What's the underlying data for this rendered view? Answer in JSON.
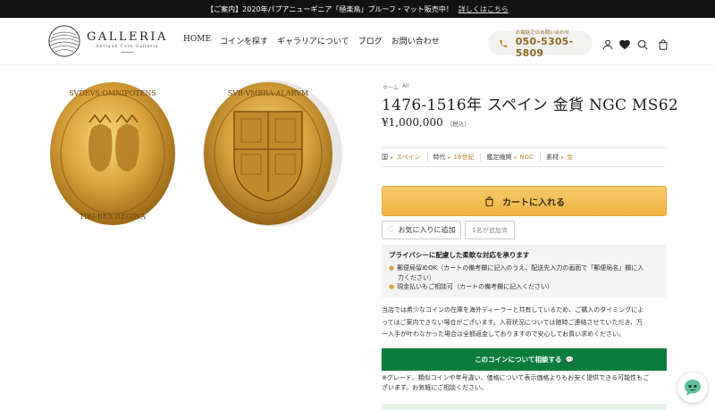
{
  "announcement": {
    "text": "【ご案内】2020年パプアニューギニア「極楽鳥」プルーフ・マット販売中！",
    "link": "詳しくはこちら"
  },
  "brand": {
    "name": "GALLERIA",
    "subtitle": "Antique Coin Galleria"
  },
  "nav": {
    "items": [
      "HOME",
      "コインを探す",
      "ギャラリアについて",
      "ブログ",
      "お問い合わせ"
    ]
  },
  "phone": {
    "label": "お電話でのお問い合わせ",
    "number": "050-5305-5809"
  },
  "header_icons": [
    "user-icon",
    "heart-icon",
    "search-icon",
    "bag-icon"
  ],
  "breadcrumb": {
    "home": "ホーム",
    "current": "All"
  },
  "product": {
    "title": "1476-1516年 スペイン 金貨 NGC MS62",
    "price": "¥1,000,000",
    "tax": "（税込）",
    "attributes": [
      {
        "label": "国",
        "value": "スペイン"
      },
      {
        "label": "時代",
        "value": "16世紀"
      },
      {
        "label": "鑑定機関",
        "value": "NGC"
      },
      {
        "label": "素材",
        "value": "金"
      }
    ],
    "cart_button": "カートに入れる",
    "favorite_button": "お気に入りに追加",
    "favorite_count": "1名が追加済"
  },
  "privacy": {
    "title": "プライバシーに配慮した柔軟な対応を承ります",
    "items": [
      "郵便局留めOK（カートの備考欄に記入のうえ、配送先入力の画面で「郵便局名」欄に入",
      "力ください）",
      "現金払いもご相談可（カートの備考欄に記入ください）"
    ]
  },
  "description": {
    "lines": [
      "当店では希少なコインの在庫を海外ディーラーと共有しているため、ご購入のタイミングによ",
      "ってはご案内できない場合がございます。入荷状況については随時ご連絡させていただき、万",
      "一入手が叶わなかった場合は全額返金しておりますので安心してお買い求めください。"
    ]
  },
  "consult_button": "このコインについて相談する",
  "note": {
    "lines": [
      "※グレード、類似コインや年号違い、価格について表示価格よりもお安く提供できる可能性もご",
      "ざいます。お気軽にご相談ください。"
    ]
  },
  "colors": {
    "accent_gold": "#efb542",
    "consult_green": "#0a7d3c",
    "link_gold": "#b8892d",
    "announcement_bg": "#111111"
  }
}
